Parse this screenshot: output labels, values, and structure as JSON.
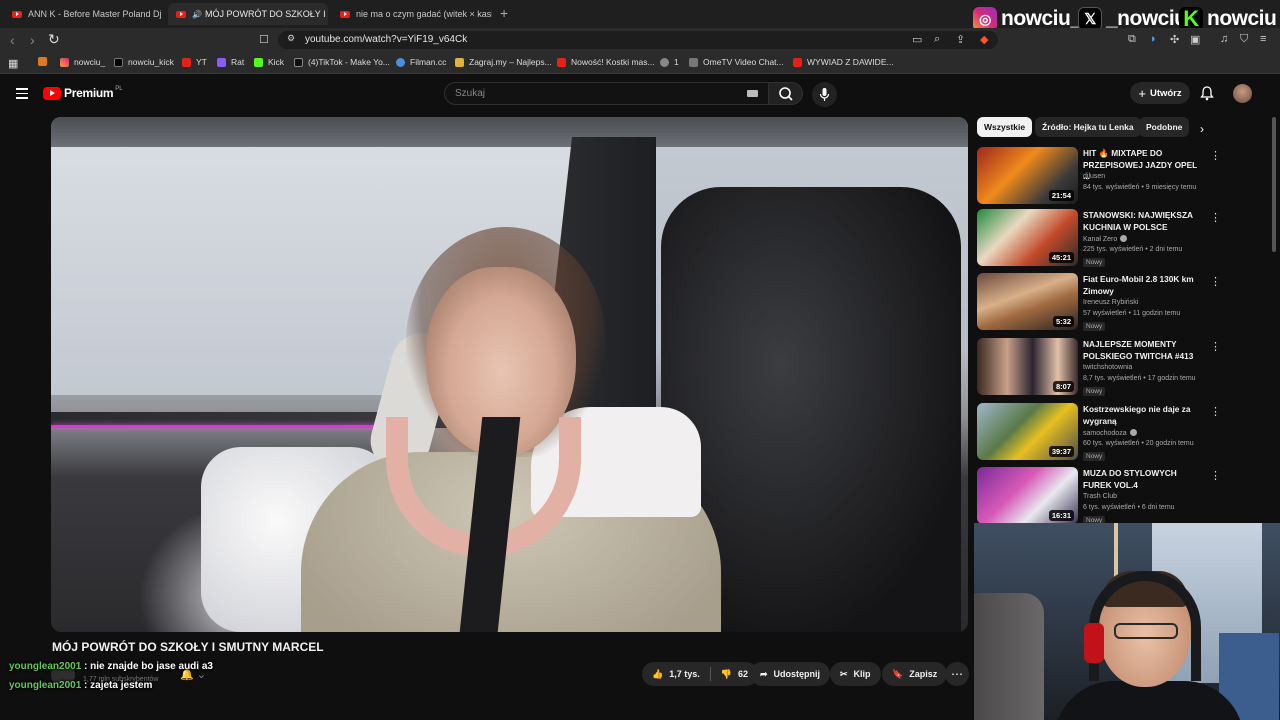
{
  "browser": {
    "tabs": [
      {
        "label": "ANN K - Before Master Poland Dj Ba",
        "active": false
      },
      {
        "label": "MÓJ POWRÓT DO SZKOŁY I S",
        "active": true
      },
      {
        "label": "nie ma o czym gadać (witek × kasix",
        "active": false
      }
    ],
    "url": "youtube.com/watch?v=YiF19_v64Ck",
    "bookmarks": [
      "nowciu_",
      "nowciu_kick",
      "YT",
      "Rat",
      "Kick",
      "(4)TikTok - Make Yo...",
      "Filman.cc",
      "Zagraj.my – Najleps...",
      "Nowość! Kostki mas...",
      "1",
      "OmeTV Video Chat...",
      "WYWIAD Z DAWIDE..."
    ]
  },
  "overlay": {
    "instagram": "nowciu_",
    "x": "_nowciu",
    "kick": "nowciu"
  },
  "yt": {
    "brand": "Premium",
    "region": "PL",
    "search_placeholder": "Szukaj",
    "create_label": "Utwórz"
  },
  "video": {
    "title": "MÓJ POWRÓT DO SZKOŁY I SMUTNY MARCEL",
    "subs": "1,77 mln subskrybentów",
    "likes": "1,7 tys.",
    "dislikes": "62",
    "share": "Udostępnij",
    "clip": "Klip",
    "save": "Zapisz"
  },
  "chat": [
    {
      "user": "younglean2001",
      "msg": "nie znajde bo jase audi a3",
      "sep": " : "
    },
    {
      "user": "younglean2001",
      "msg": "zajeta jestem",
      "sep": " : "
    }
  ],
  "chips": [
    "Wszystkie",
    "Źródło: Hejka tu Lenka",
    "Podobne"
  ],
  "recommended": [
    {
      "title": "HIT 🔥 MIXTAPE DO PRZEPISOWEJ JAZDY OPEL ...",
      "channel": "djlusen",
      "meta": "84 tys. wyświetleń • 9 miesięcy temu",
      "duration": "21:54",
      "badge": "",
      "verified": false
    },
    {
      "title": "STANOWSKI: NAJWIĘKSZA KUCHNIA W POLSCE",
      "channel": "Kanał Zero",
      "meta": "225 tys. wyświetleń • 2 dni temu",
      "duration": "45:21",
      "badge": "Nowy",
      "verified": true
    },
    {
      "title": "Fiat Euro-Mobil 2.8 130K km Zimowy",
      "channel": "Ireneusz Rybiński",
      "meta": "57 wyświetleń • 11 godzin temu",
      "duration": "5:32",
      "badge": "Nowy",
      "verified": false
    },
    {
      "title": "NAJLEPSZE MOMENTY POLSKIEGO TWITCHA #413",
      "channel": "twitchshotownia",
      "meta": "8,7 tys. wyświetleń • 17 godzin temu",
      "duration": "8:07",
      "badge": "Nowy",
      "verified": false
    },
    {
      "title": "Kostrzewskiego nie daje za wygraną",
      "channel": "samochodoza",
      "meta": "60 tys. wyświetleń • 20 godzin temu",
      "duration": "39:37",
      "badge": "Nowy",
      "verified": true
    },
    {
      "title": "MUZA DO STYLOWYCH FUREK VOL.4",
      "channel": "Trash Club",
      "meta": "6 tys. wyświetleń • 6 dni temu",
      "duration": "16:31",
      "badge": "Nowy",
      "verified": false
    }
  ],
  "icons": {
    "back": "arrow-left",
    "forward": "arrow-right",
    "reload": "reload",
    "menu": "hamburger",
    "search": "magnifier",
    "mic": "microphone",
    "bell": "bell",
    "like": "thumb-up",
    "dislike": "thumb-down",
    "share": "share-arrow",
    "clip": "scissors",
    "save": "bookmark",
    "more": "ellipsis"
  },
  "colors": {
    "yt_red": "#ff0000",
    "chat_user": "#62c75a",
    "kick_green": "#53fc18",
    "background": "#0f0f0f"
  }
}
